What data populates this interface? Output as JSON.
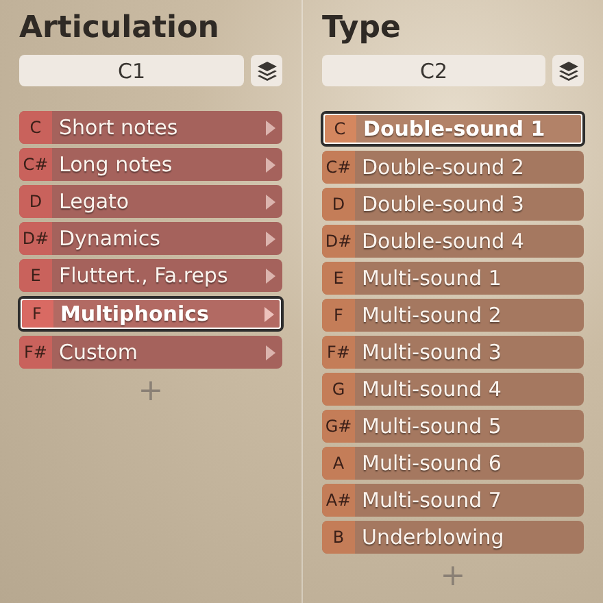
{
  "columns": [
    {
      "kind": "articulation",
      "title": "Articulation",
      "field": {
        "value": "C1"
      },
      "add": "+",
      "rows": [
        {
          "key": "C",
          "label": "Short notes",
          "selected": false
        },
        {
          "key": "C#",
          "label": "Long notes",
          "selected": false
        },
        {
          "key": "D",
          "label": "Legato",
          "selected": false
        },
        {
          "key": "D#",
          "label": "Dynamics",
          "selected": false
        },
        {
          "key": "E",
          "label": "Fluttert., Fa.reps",
          "selected": false
        },
        {
          "key": "F",
          "label": "Multiphonics",
          "selected": true
        },
        {
          "key": "F#",
          "label": "Custom",
          "selected": false
        }
      ]
    },
    {
      "kind": "type",
      "title": "Type",
      "field": {
        "value": "C2"
      },
      "add": "+",
      "rows": [
        {
          "key": "C",
          "label": "Double-sound 1",
          "selected": true
        },
        {
          "key": "C#",
          "label": "Double-sound 2",
          "selected": false
        },
        {
          "key": "D",
          "label": "Double-sound 3",
          "selected": false
        },
        {
          "key": "D#",
          "label": "Double-sound 4",
          "selected": false
        },
        {
          "key": "E",
          "label": "Multi-sound 1",
          "selected": false
        },
        {
          "key": "F",
          "label": "Multi-sound 2",
          "selected": false
        },
        {
          "key": "F#",
          "label": "Multi-sound 3",
          "selected": false
        },
        {
          "key": "G",
          "label": "Multi-sound 4",
          "selected": false
        },
        {
          "key": "G#",
          "label": "Multi-sound 5",
          "selected": false
        },
        {
          "key": "A",
          "label": "Multi-sound 6",
          "selected": false
        },
        {
          "key": "A#",
          "label": "Multi-sound 7",
          "selected": false
        },
        {
          "key": "B",
          "label": "Underblowing",
          "selected": false
        }
      ]
    }
  ]
}
